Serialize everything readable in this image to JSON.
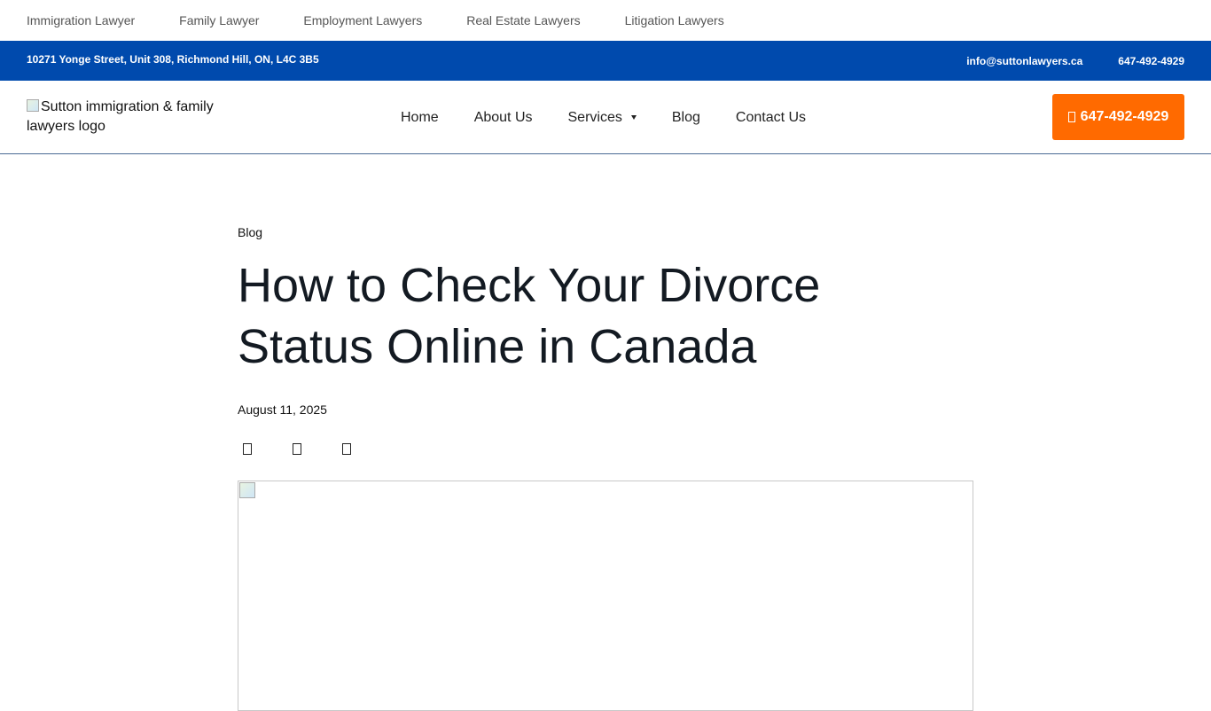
{
  "practice_nav": [
    "Immigration Lawyer",
    "Family Lawyer",
    "Employment Lawyers",
    "Real Estate Lawyers",
    "Litigation Lawyers"
  ],
  "infobar": {
    "address": "10271 Yonge Street, Unit 308, Richmond Hill, ON, L4C 3B5",
    "email": "info@suttonlawyers.ca",
    "phone": "647-492-4929",
    "background": "#004aad"
  },
  "header": {
    "logo_alt": "Sutton immigration & family lawyers logo",
    "nav": {
      "home": "Home",
      "about": "About Us",
      "services": "Services",
      "blog": "Blog",
      "contact": "Contact Us"
    },
    "call_button": "647-492-4929",
    "call_button_color": "#ff6a00",
    "call_icon": "phone-icon"
  },
  "article": {
    "category": "Blog",
    "title": "How to Check Your Divorce Status Online in Canada",
    "date": "August 11, 2025",
    "share_icons": [
      "facebook-icon",
      "twitter-icon",
      "linkedin-icon"
    ]
  }
}
